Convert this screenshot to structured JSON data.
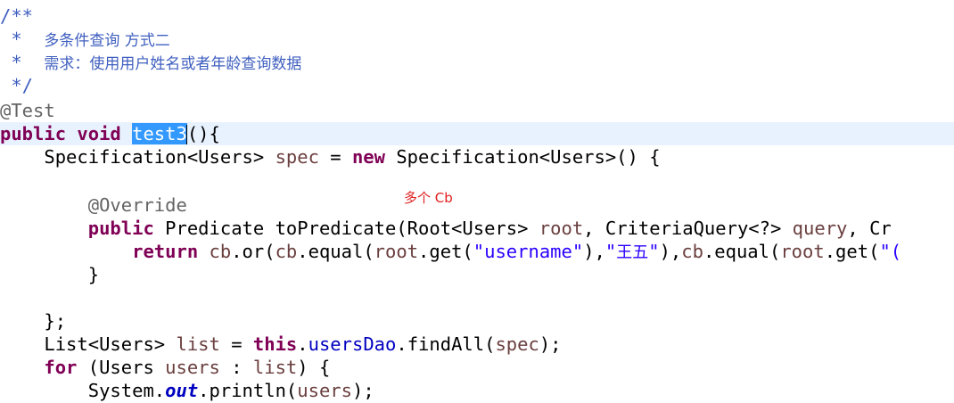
{
  "code": {
    "lines": [
      [
        [
          "comment",
          "/**"
        ]
      ],
      [
        [
          "comment",
          " *  "
        ],
        [
          "comment-cjk",
          "多条件查询 方式二"
        ]
      ],
      [
        [
          "comment",
          " *  "
        ],
        [
          "comment-cjk",
          "需求：使用用户姓名或者年龄查询数据"
        ]
      ],
      [
        [
          "comment",
          " */"
        ]
      ],
      [
        [
          "annotation",
          "@Test"
        ]
      ],
      [
        [
          "kw",
          "public"
        ],
        [
          "plain",
          " "
        ],
        [
          "kw",
          "void"
        ],
        [
          "plain",
          " "
        ],
        [
          "selected",
          "test3"
        ],
        [
          "caret",
          ""
        ],
        [
          "plain",
          "(){"
        ]
      ],
      [
        [
          "plain",
          "    Specification<Users> "
        ],
        [
          "param",
          "spec"
        ],
        [
          "plain",
          " = "
        ],
        [
          "kw",
          "new"
        ],
        [
          "plain",
          " Specification<Users>() {"
        ]
      ],
      [],
      [
        [
          "annotation",
          "        @Override"
        ]
      ],
      [
        [
          "plain",
          "        "
        ],
        [
          "kw",
          "public"
        ],
        [
          "plain",
          " Predicate toPredicate(Root<Users> "
        ],
        [
          "param",
          "root"
        ],
        [
          "plain",
          ", CriteriaQuery<?> "
        ],
        [
          "param",
          "query"
        ],
        [
          "plain",
          ", Cr"
        ]
      ],
      [
        [
          "plain",
          "            "
        ],
        [
          "kw",
          "return"
        ],
        [
          "plain",
          " "
        ],
        [
          "param",
          "cb"
        ],
        [
          "plain",
          ".or("
        ],
        [
          "param",
          "cb"
        ],
        [
          "plain",
          ".equal("
        ],
        [
          "param",
          "root"
        ],
        [
          "plain",
          ".get("
        ],
        [
          "str",
          "\"username\""
        ],
        [
          "plain",
          "),"
        ],
        [
          "str",
          "\""
        ],
        [
          "str-cjk",
          "王五"
        ],
        [
          "str",
          "\""
        ],
        [
          "plain",
          "),"
        ],
        [
          "param",
          "cb"
        ],
        [
          "plain",
          ".equal("
        ],
        [
          "param",
          "root"
        ],
        [
          "plain",
          ".get("
        ],
        [
          "str",
          "\"("
        ]
      ],
      [
        [
          "plain",
          "        }"
        ]
      ],
      [],
      [
        [
          "plain",
          "    };"
        ]
      ],
      [
        [
          "plain",
          "    List<Users> "
        ],
        [
          "param",
          "list"
        ],
        [
          "plain",
          " = "
        ],
        [
          "kw",
          "this"
        ],
        [
          "plain",
          "."
        ],
        [
          "field",
          "usersDao"
        ],
        [
          "plain",
          ".findAll("
        ],
        [
          "param",
          "spec"
        ],
        [
          "plain",
          ");"
        ]
      ],
      [
        [
          "plain",
          "    "
        ],
        [
          "kw",
          "for"
        ],
        [
          "plain",
          " (Users "
        ],
        [
          "param",
          "users"
        ],
        [
          "plain",
          " : "
        ],
        [
          "param",
          "list"
        ],
        [
          "plain",
          ") {"
        ]
      ],
      [
        [
          "plain",
          "        System."
        ],
        [
          "static-field",
          "out"
        ],
        [
          "plain",
          ".println("
        ],
        [
          "param",
          "users"
        ],
        [
          "plain",
          ");"
        ]
      ]
    ],
    "current_line": 6
  },
  "overlay_note": "多个 Cb"
}
